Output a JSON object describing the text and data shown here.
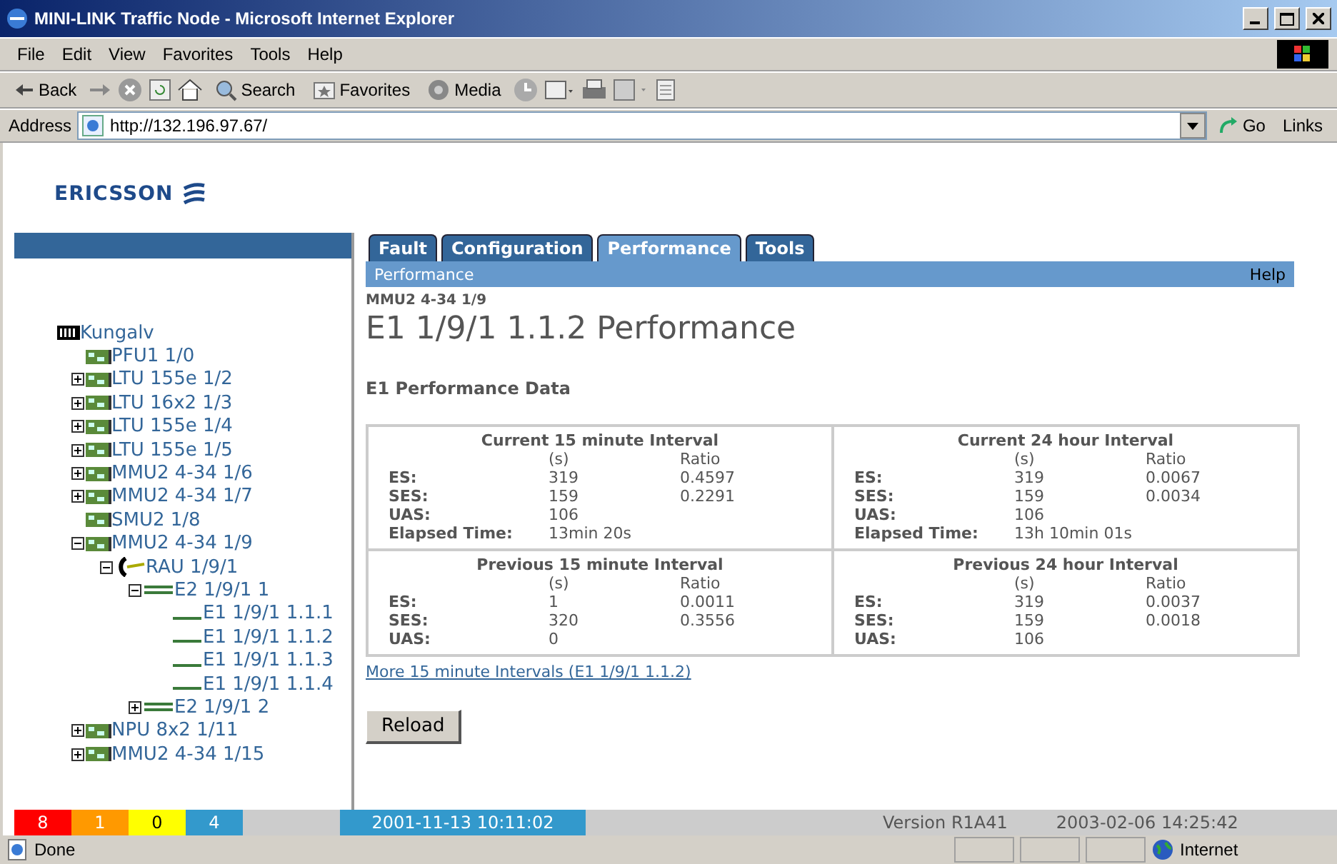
{
  "window": {
    "title": "MINI-LINK Traffic Node - Microsoft Internet Explorer"
  },
  "menu": [
    "File",
    "Edit",
    "View",
    "Favorites",
    "Tools",
    "Help"
  ],
  "toolbar": {
    "back": "Back",
    "search": "Search",
    "favorites": "Favorites",
    "media": "Media"
  },
  "address": {
    "label": "Address",
    "value": "http://132.196.97.67/",
    "go": "Go",
    "links": "Links"
  },
  "logo": {
    "text": "ERICSSON"
  },
  "tree": [
    {
      "label": "Kungalv",
      "kind": "rack",
      "children": [
        {
          "label": "PFU1 1/0",
          "kind": "board"
        },
        {
          "label": "LTU 155e 1/2",
          "kind": "board",
          "expanded": false
        },
        {
          "label": "LTU 16x2 1/3",
          "kind": "board",
          "expanded": false
        },
        {
          "label": "LTU 155e 1/4",
          "kind": "board",
          "expanded": false
        },
        {
          "label": "LTU 155e 1/5",
          "kind": "board",
          "expanded": false
        },
        {
          "label": "MMU2 4-34 1/6",
          "kind": "board",
          "expanded": false
        },
        {
          "label": "MMU2 4-34 1/7",
          "kind": "board",
          "expanded": false
        },
        {
          "label": "SMU2 1/8",
          "kind": "board"
        },
        {
          "label": "MMU2 4-34 1/9",
          "kind": "board",
          "expanded": true,
          "children": [
            {
              "label": "RAU 1/9/1",
              "kind": "radio",
              "expanded": true,
              "children": [
                {
                  "label": "E2 1/9/1 1",
                  "kind": "e2",
                  "expanded": true,
                  "children": [
                    {
                      "label": "E1 1/9/1 1.1.1",
                      "kind": "e1"
                    },
                    {
                      "label": "E1 1/9/1 1.1.2",
                      "kind": "e1"
                    },
                    {
                      "label": "E1 1/9/1 1.1.3",
                      "kind": "e1"
                    },
                    {
                      "label": "E1 1/9/1 1.1.4",
                      "kind": "e1"
                    }
                  ]
                },
                {
                  "label": "E2 1/9/1 2",
                  "kind": "e2",
                  "expanded": false
                }
              ]
            }
          ]
        },
        {
          "label": "NPU 8x2 1/11",
          "kind": "board",
          "expanded": false
        },
        {
          "label": "MMU2 4-34 1/15",
          "kind": "board",
          "expanded": false
        }
      ]
    }
  ],
  "tabs": [
    {
      "label": "Fault",
      "selected": false
    },
    {
      "label": "Configuration",
      "selected": false
    },
    {
      "label": "Performance",
      "selected": true
    },
    {
      "label": "Tools",
      "selected": false
    }
  ],
  "subbar": {
    "title": "Performance",
    "help": "Help"
  },
  "breadcrumb": "MMU2 4-34 1/9",
  "heading": "E1 1/9/1 1.1.2 Performance",
  "section": "E1 Performance Data",
  "intervals": [
    {
      "title": "Current 15 minute Interval",
      "col_s": "(s)",
      "col_ratio": "Ratio",
      "rows": [
        {
          "label": "ES:",
          "s": "319",
          "ratio": "0.4597"
        },
        {
          "label": "SES:",
          "s": "159",
          "ratio": "0.2291"
        },
        {
          "label": "UAS:",
          "s": "106"
        }
      ],
      "elapsed": {
        "label": "Elapsed Time:",
        "value": "13min 20s"
      }
    },
    {
      "title": "Current 24 hour Interval",
      "col_s": "(s)",
      "col_ratio": "Ratio",
      "rows": [
        {
          "label": "ES:",
          "s": "319",
          "ratio": "0.0067"
        },
        {
          "label": "SES:",
          "s": "159",
          "ratio": "0.0034"
        },
        {
          "label": "UAS:",
          "s": "106"
        }
      ],
      "elapsed": {
        "label": "Elapsed Time:",
        "value": "13h 10min 01s"
      }
    },
    {
      "title": "Previous 15 minute Interval",
      "col_s": "(s)",
      "col_ratio": "Ratio",
      "rows": [
        {
          "label": "ES:",
          "s": "1",
          "ratio": "0.0011"
        },
        {
          "label": "SES:",
          "s": "320",
          "ratio": "0.3556"
        },
        {
          "label": "UAS:",
          "s": "0"
        }
      ]
    },
    {
      "title": "Previous 24 hour Interval",
      "col_s": "(s)",
      "col_ratio": "Ratio",
      "rows": [
        {
          "label": "ES:",
          "s": "319",
          "ratio": "0.0037"
        },
        {
          "label": "SES:",
          "s": "159",
          "ratio": "0.0018"
        },
        {
          "label": "UAS:",
          "s": "106"
        }
      ]
    }
  ],
  "more_link": "More 15 minute Intervals (E1 1/9/1 1.1.2)",
  "reload": "Reload",
  "alarms": [
    {
      "count": "8",
      "color": "#ff0000"
    },
    {
      "count": "1",
      "color": "#ff9900"
    },
    {
      "count": "0",
      "color": "#ffff00"
    },
    {
      "count": "4",
      "color": "#3399cc"
    }
  ],
  "footer": {
    "date": "2001-11-13 10:11:02",
    "version": "Version R1A41",
    "time": "2003-02-06 14:25:42"
  },
  "status": {
    "text": "Done",
    "zone": "Internet"
  }
}
